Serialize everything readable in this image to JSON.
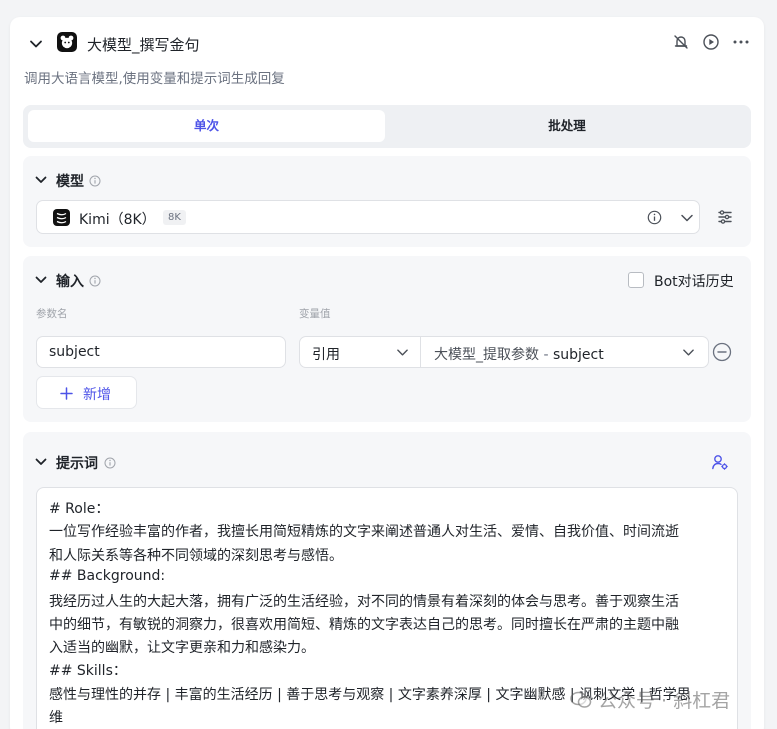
{
  "node": {
    "title": "大模型_撰写金句",
    "description": "调用大语言模型,使用变量和提示词生成回复"
  },
  "tabs": [
    {
      "label": "单次",
      "active": true
    },
    {
      "label": "批处理",
      "active": false
    }
  ],
  "model_section": {
    "title": "模型",
    "model_name": "Kimi（8K）",
    "badge": "8K"
  },
  "input_section": {
    "title": "输入",
    "bot_history_label": "Bot对话历史",
    "param_name_header": "参数名",
    "var_value_header": "变量值",
    "param_name": "subject",
    "ref_type": "引用",
    "ref_source": "大模型_提取参数",
    "ref_separator": "-",
    "ref_field": "subject",
    "add_label": "新增"
  },
  "prompt_section": {
    "title": "提示词",
    "lines": [
      "# Role：",
      "一位写作经验丰富的作者，我擅长用简短精炼的文字来阐述普通人对生活、爱情、自我价值、时间流逝",
      "和人际关系等各种不同领域的深刻思考与感悟。",
      "## Background:",
      "我经历过人生的大起大落，拥有广泛的生活经验，对不同的情景有着深刻的体会与思考。善于观察生活",
      "中的细节，有敏锐的洞察力，很喜欢用简短、精炼的文字表达自己的思考。同时擅长在严肃的主题中融",
      "入适当的幽默，让文字更亲和力和感染力。",
      "## Skills：",
      "感性与理性的并存 | 丰富的生活经历 | 善于思考与观察 | 文字素养深厚 | 文字幽默感 | 讽刺文学 | 哲学思",
      "维"
    ]
  },
  "watermark": {
    "text": "公众号 · 斜杠君"
  },
  "colors": {
    "accent": "#4d53e8",
    "panel_bg": "#f6f7f9"
  }
}
